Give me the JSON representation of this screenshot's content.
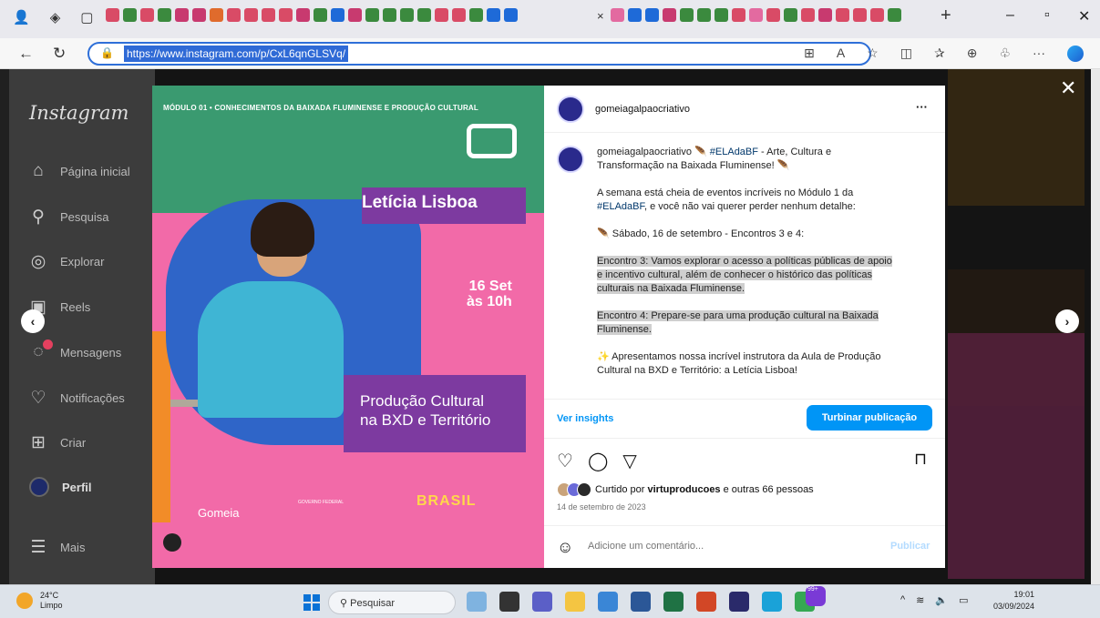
{
  "browser": {
    "url": "https://www.instagram.com/p/CxL6qnGLSVq/",
    "new_tab": "+",
    "tab_close": "×",
    "minimize": "–",
    "maximize": "▫",
    "close": "✕"
  },
  "sidebar": {
    "logo": "Instagram",
    "items": [
      {
        "label": "Página inicial",
        "icon": "home-icon",
        "glyph": "⌂"
      },
      {
        "label": "Pesquisa",
        "icon": "search-icon",
        "glyph": "⚲"
      },
      {
        "label": "Explorar",
        "icon": "compass-icon",
        "glyph": "◎"
      },
      {
        "label": "Reels",
        "icon": "reels-icon",
        "glyph": "▣"
      },
      {
        "label": "Mensagens",
        "icon": "messenger-icon",
        "glyph": "◌"
      },
      {
        "label": "Notificações",
        "icon": "heart-icon",
        "glyph": "♡"
      },
      {
        "label": "Criar",
        "icon": "plus-square-icon",
        "glyph": "⊞"
      },
      {
        "label": "Perfil",
        "icon": "avatar",
        "glyph": ""
      },
      {
        "label": "Mais",
        "icon": "menu-icon",
        "glyph": "☰"
      }
    ]
  },
  "post_image": {
    "module_header": "MÓDULO 01 • CONHECIMENTOS DA BAIXADA FLUMINENSE E PRODUÇÃO CULTURAL",
    "name": "Letícia Lisboa",
    "date_line1": "16 Set",
    "date_line2": "às 10h",
    "title_line1": "Produção Cultural",
    "title_line2": "na BXD e Território",
    "gomeia": "Gomeia",
    "brasil": "BRASIL",
    "governo": "GOVERNO FEDERAL"
  },
  "panel": {
    "username": "gomeiagalpaocriativo",
    "more": "···",
    "caption_user": "gomeiagalpaocriativo",
    "caption_intro_tag": "#ELAdaBF",
    "caption_intro_rest": " - Arte, Cultura e Transformação na Baixada Fluminense!",
    "p1_start": "A semana está cheia de eventos incríveis no Módulo 1 da ",
    "p1_tag": "#ELAdaBF",
    "p1_end": ", e você não vai querer perder nenhum detalhe:",
    "p2": "Sábado, 16 de setembro - Encontros 3 e 4:",
    "p3": "Encontro 3: Vamos explorar o acesso a políticas públicas de apoio e incentivo cultural, além de conhecer o histórico das políticas culturais na Baixada Fluminense.",
    "p4": "Encontro 4: Prepare-se para uma produção cultural na Baixada Fluminense.",
    "p5": "Apresentamos nossa incrível instrutora da Aula de Produção Cultural na BXD e Território: a Letícia Lisboa!",
    "insights": "Ver insights",
    "boost": "Turbinar publicação",
    "likes_prefix": "Curtido por ",
    "likes_user": "virtuproducoes",
    "likes_suffix": " e outras 66 pessoas",
    "date": "14 de setembro de 2023",
    "comment_placeholder": "Adicione um comentário...",
    "publish": "Publicar"
  },
  "taskbar": {
    "temp": "24°C",
    "weather": "Limpo",
    "search": "Pesquisar",
    "time": "19:01",
    "date": "03/09/2024",
    "badge": "99+"
  },
  "colors": {
    "accent": "#0095f6",
    "pink": "#f26aa8",
    "purple": "#7d3aa0",
    "green": "#3a9a70"
  }
}
